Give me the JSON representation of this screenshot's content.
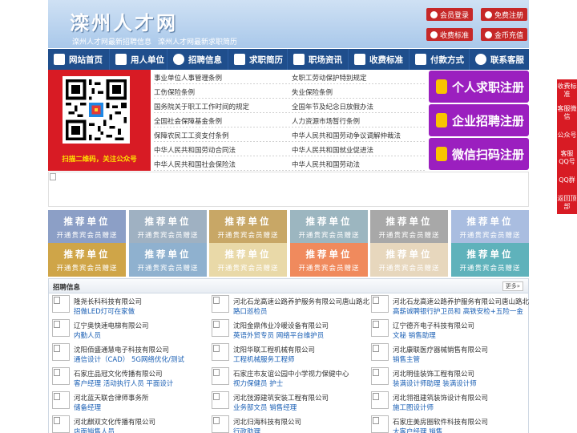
{
  "site": {
    "title": "滦州人才网",
    "slogan": [
      "滦州人才网最新招聘信息",
      "滦州人才网最新求职简历"
    ]
  },
  "header_buttons": [
    "会员登录",
    "免费注册",
    "收费标准",
    "金币充值"
  ],
  "nav": [
    "网站首页",
    "用人单位",
    "招聘信息",
    "求职简历",
    "职场资讯",
    "收费标准",
    "付款方式",
    "联系客服"
  ],
  "qr_caption": "扫描二维码，关注公众号",
  "laws": [
    [
      "事业单位人事管理条例",
      "女职工劳动保护特别规定"
    ],
    [
      "工伤保险条例",
      "失业保险条例"
    ],
    [
      "国务院关于职工工作时间的规定",
      "全国年节及纪念日放假办法"
    ],
    [
      "全国社会保障基金条例",
      "人力资源市场暂行条例"
    ],
    [
      "保障农民工工资支付条例",
      "中华人民共和国劳动争议调解仲裁法"
    ],
    [
      "中华人民共和国劳动合同法",
      "中华人民共和国就业促进法"
    ],
    [
      "中华人民共和国社会保险法",
      "中华人民共和国劳动法"
    ]
  ],
  "register_buttons": [
    "个人求职注册",
    "企业招聘注册",
    "微信扫码注册"
  ],
  "ad_tiles": {
    "line1": "推荐单位",
    "line2": "开通贵宾会员赠送",
    "colors": [
      "#8c9fc6",
      "#9fb1c2",
      "#c8a766",
      "#9cb6c0",
      "#a8a8a8",
      "#a9bde0",
      "#cfa548",
      "#8fb1cf",
      "#e9d9a8",
      "#f08a5d",
      "#e7d7bd",
      "#5fb2bb"
    ]
  },
  "jobs": {
    "title": "招聘信息",
    "more": "更多»",
    "columns": [
      [
        {
          "company": "隆尧长科科技有限公司",
          "positions": "招做LED灯可在家做"
        },
        {
          "company": "辽宁奥快速电梯有限公司",
          "positions": "内勤人员"
        },
        {
          "company": "沈阳佰盛通慧电子科技有限公司",
          "positions": "通信设计（CAD） 5G网络优化/测试"
        },
        {
          "company": "石家庄品冠文化传播有限公司",
          "positions": "客户经理 活动执行人员 平面设计"
        },
        {
          "company": "河北蓝天联合律师事务所",
          "positions": "储备经理"
        },
        {
          "company": "河北麒双文化传播有限公司",
          "positions": "店面销售人员"
        }
      ],
      [
        {
          "company": "河北石龙高速公路养护服务有限公司唐山路北",
          "positions": "路口巡检员"
        },
        {
          "company": "沈阳金鼎伟业冷暖设备有限公司",
          "positions": "英语外贸专员 网络平台维护员"
        },
        {
          "company": "沈阳华联工程机械有限公司",
          "positions": "工程机械服务工程师"
        },
        {
          "company": "石家庄市友谊公园中小学视力保健中心",
          "positions": "视力保健员 护士"
        },
        {
          "company": "河北弢源建筑安装工程有限公司",
          "positions": "业务部文员 销售经理"
        },
        {
          "company": "河北归海科技有限公司",
          "positions": "行政助理"
        }
      ],
      [
        {
          "company": "河北石龙高速公路养护服务有限公司唐山路北",
          "positions": "高薪诚聘银行护卫员和 高铁安检+五险一金"
        },
        {
          "company": "辽宁德齐电子科技有限公司",
          "positions": "文秘 销售助理"
        },
        {
          "company": "河北康联医疗器械销售有限公司",
          "positions": "销售主管"
        },
        {
          "company": "河北明佳装饰工程有限公司",
          "positions": "装满设计师助理 装满设计师"
        },
        {
          "company": "河北翎祖建筑装饰设计有限公司",
          "positions": "施工图设计师"
        },
        {
          "company": "石家庄美房圈软件科技有限公司",
          "positions": "大客户经理 销售"
        }
      ]
    ]
  },
  "side_float": [
    "收费标准",
    "客服微信",
    "公众号",
    "客服QQ号",
    "QQ群",
    "返回顶部"
  ]
}
